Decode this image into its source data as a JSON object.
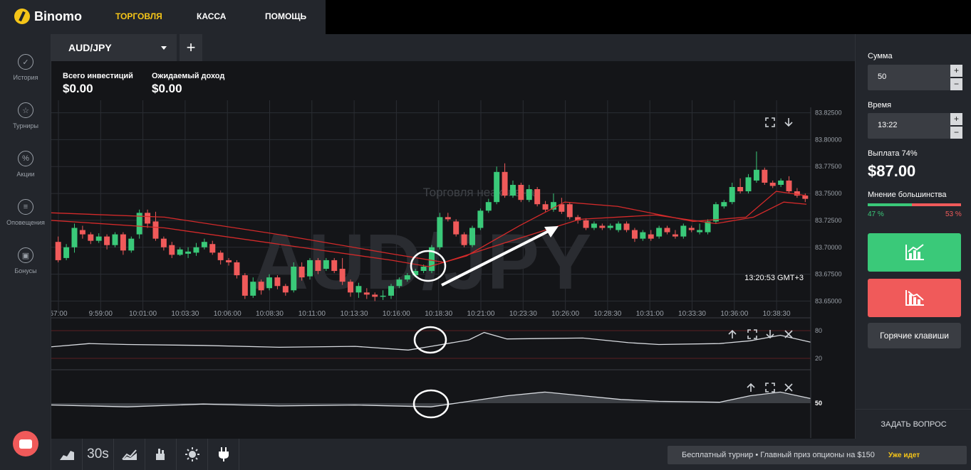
{
  "app": {
    "logo_text": "Binomo"
  },
  "nav": [
    {
      "label": "ТОРГОВЛЯ",
      "active": true
    },
    {
      "label": "КАССА",
      "active": false
    },
    {
      "label": "ПОМОЩЬ",
      "active": false
    }
  ],
  "sidebar": {
    "items": [
      {
        "label": "История",
        "icon": "check-icon"
      },
      {
        "label": "Турниры",
        "icon": "star-icon"
      },
      {
        "label": "Акции",
        "icon": "percent-icon"
      },
      {
        "label": "Оповещения",
        "icon": "list-icon"
      },
      {
        "label": "Бонусы",
        "icon": "gift-icon"
      }
    ]
  },
  "tabs": {
    "asset": "AUD/JPY",
    "add": "+"
  },
  "info": {
    "total_label": "Всего инвестиций",
    "total_value": "$0.00",
    "expected_label": "Ожидаемый доход",
    "expected_value": "$0.00"
  },
  "chart": {
    "watermark": "AUD/JPY",
    "status_text": "Торговля неактивна",
    "time_readout": "13:20:53 GMT+3",
    "price_ticks": [
      "83.82500",
      "83.80000",
      "83.77500",
      "83.75000",
      "83.72500",
      "83.70000",
      "83.67500",
      "83.65000"
    ],
    "time_ticks": [
      "57:00",
      "9:59:00",
      "10:01:00",
      "10:03:30",
      "10:06:00",
      "10:08:30",
      "10:11:00",
      "10:13:30",
      "10:16:00",
      "10:18:30",
      "10:21:00",
      "10:23:30",
      "10:26:00",
      "10:28:30",
      "10:31:00",
      "10:33:30",
      "10:36:00",
      "10:38:30"
    ],
    "osc1_ticks": [
      "80",
      "20"
    ],
    "osc2_ticks": [
      "50"
    ],
    "colors": {
      "up": "#3ac979",
      "down": "#f05a5a",
      "ma": "#d42a2a",
      "grid": "#2a2d33"
    }
  },
  "chart_data": {
    "type": "candlestick",
    "ylim": [
      83.645,
      83.83
    ],
    "candles": [
      [
        83.705,
        83.688,
        83.71,
        83.686
      ],
      [
        83.69,
        83.7,
        83.703,
        83.688
      ],
      [
        83.7,
        83.718,
        83.722,
        83.695
      ],
      [
        83.716,
        83.712,
        83.72,
        83.708
      ],
      [
        83.712,
        83.706,
        83.714,
        83.703
      ],
      [
        83.706,
        83.71,
        83.713,
        83.704
      ],
      [
        83.71,
        83.702,
        83.712,
        83.698
      ],
      [
        83.702,
        83.712,
        83.714,
        83.7
      ],
      [
        83.712,
        83.697,
        83.714,
        83.693
      ],
      [
        83.697,
        83.708,
        83.71,
        83.695
      ],
      [
        83.712,
        83.732,
        83.735,
        83.708
      ],
      [
        83.732,
        83.722,
        83.735,
        83.718
      ],
      [
        83.724,
        83.708,
        83.733,
        83.706
      ],
      [
        83.708,
        83.7,
        83.71,
        83.697
      ],
      [
        83.702,
        83.693,
        83.705,
        83.69
      ],
      [
        83.693,
        83.698,
        83.7,
        83.692
      ],
      [
        83.694,
        83.696,
        83.7,
        83.69
      ],
      [
        83.695,
        83.7,
        83.704,
        83.692
      ],
      [
        83.7,
        83.705,
        83.708,
        83.698
      ],
      [
        83.703,
        83.695,
        83.706,
        83.693
      ],
      [
        83.695,
        83.688,
        83.697,
        83.684
      ],
      [
        83.688,
        83.686,
        83.69,
        83.683
      ],
      [
        83.686,
        83.674,
        83.688,
        83.671
      ],
      [
        83.674,
        83.655,
        83.676,
        83.652
      ],
      [
        83.655,
        83.668,
        83.672,
        83.653
      ],
      [
        83.668,
        83.66,
        83.67,
        83.656
      ],
      [
        83.662,
        83.672,
        83.675,
        83.66
      ],
      [
        83.672,
        83.664,
        83.674,
        83.661
      ],
      [
        83.664,
        83.658,
        83.666,
        83.655
      ],
      [
        83.66,
        83.682,
        83.686,
        83.658
      ],
      [
        83.682,
        83.672,
        83.686,
        83.669
      ],
      [
        83.673,
        83.688,
        83.69,
        83.67
      ],
      [
        83.688,
        83.678,
        83.69,
        83.675
      ],
      [
        83.68,
        83.688,
        83.69,
        83.678
      ],
      [
        83.688,
        83.678,
        83.69,
        83.676
      ],
      [
        83.68,
        83.668,
        83.69,
        83.665
      ],
      [
        83.668,
        83.658,
        83.67,
        83.654
      ],
      [
        83.658,
        83.664,
        83.667,
        83.653
      ],
      [
        83.658,
        83.656,
        83.662,
        83.652
      ],
      [
        83.656,
        83.654,
        83.658,
        83.65
      ],
      [
        83.655,
        83.655,
        83.66,
        83.651
      ],
      [
        83.655,
        83.664,
        83.666,
        83.652
      ],
      [
        83.664,
        83.67,
        83.672,
        83.662
      ],
      [
        83.67,
        83.674,
        83.676,
        83.668
      ],
      [
        83.674,
        83.678,
        83.68,
        83.672
      ],
      [
        83.678,
        83.682,
        83.684,
        83.676
      ],
      [
        83.678,
        83.7,
        83.702,
        83.676
      ],
      [
        83.7,
        83.728,
        83.732,
        83.698
      ],
      [
        83.728,
        83.726,
        83.732,
        83.724
      ],
      [
        83.724,
        83.712,
        83.726,
        83.71
      ],
      [
        83.712,
        83.702,
        83.714,
        83.7
      ],
      [
        83.702,
        83.718,
        83.72,
        83.7
      ],
      [
        83.718,
        83.734,
        83.736,
        83.716
      ],
      [
        83.734,
        83.742,
        83.745,
        83.732
      ],
      [
        83.742,
        83.77,
        83.775,
        83.74
      ],
      [
        83.77,
        83.748,
        83.778,
        83.746
      ],
      [
        83.748,
        83.758,
        83.762,
        83.746
      ],
      [
        83.758,
        83.744,
        83.76,
        83.742
      ],
      [
        83.744,
        83.754,
        83.758,
        83.742
      ],
      [
        83.754,
        83.74,
        83.756,
        83.738
      ],
      [
        83.74,
        83.735,
        83.743,
        83.733
      ],
      [
        83.735,
        83.742,
        83.75,
        83.733
      ],
      [
        83.74,
        83.733,
        83.746,
        83.731
      ],
      [
        83.74,
        83.728,
        83.742,
        83.726
      ],
      [
        83.728,
        83.725,
        83.73,
        83.722
      ],
      [
        83.725,
        83.718,
        83.727,
        83.716
      ],
      [
        83.718,
        83.722,
        83.724,
        83.716
      ],
      [
        83.72,
        83.718,
        83.722,
        83.716
      ],
      [
        83.718,
        83.72,
        83.722,
        83.716
      ],
      [
        83.716,
        83.722,
        83.724,
        83.714
      ],
      [
        83.722,
        83.716,
        83.724,
        83.714
      ],
      [
        83.716,
        83.708,
        83.718,
        83.705
      ],
      [
        83.708,
        83.714,
        83.716,
        83.706
      ],
      [
        83.712,
        83.708,
        83.716,
        83.706
      ],
      [
        83.71,
        83.718,
        83.72,
        83.708
      ],
      [
        83.718,
        83.714,
        83.72,
        83.712
      ],
      [
        83.712,
        83.71,
        83.716,
        83.708
      ],
      [
        83.71,
        83.72,
        83.722,
        83.708
      ],
      [
        83.718,
        83.716,
        83.72,
        83.714
      ],
      [
        83.714,
        83.716,
        83.722,
        83.712
      ],
      [
        83.714,
        83.724,
        83.726,
        83.712
      ],
      [
        83.724,
        83.74,
        83.742,
        83.722
      ],
      [
        83.738,
        83.742,
        83.744,
        83.736
      ],
      [
        83.742,
        83.756,
        83.76,
        83.74
      ],
      [
        83.756,
        83.752,
        83.764,
        83.75
      ],
      [
        83.752,
        83.765,
        83.768,
        83.75
      ],
      [
        83.762,
        83.772,
        83.789,
        83.76
      ],
      [
        83.772,
        83.76,
        83.774,
        83.758
      ],
      [
        83.76,
        83.757,
        83.762,
        83.755
      ],
      [
        83.758,
        83.762,
        83.764,
        83.756
      ],
      [
        83.762,
        83.752,
        83.766,
        83.75
      ],
      [
        83.752,
        83.748,
        83.755,
        83.746
      ],
      [
        83.748,
        83.745,
        83.75,
        83.742
      ]
    ],
    "ma": [
      [
        0,
        83.725
      ],
      [
        0.15,
        83.718
      ],
      [
        0.3,
        83.703
      ],
      [
        0.45,
        83.688
      ],
      [
        0.5,
        83.682
      ],
      [
        0.55,
        83.692
      ],
      [
        0.62,
        83.72
      ],
      [
        0.68,
        83.742
      ],
      [
        0.75,
        83.738
      ],
      [
        0.85,
        83.724
      ],
      [
        0.92,
        83.728
      ],
      [
        0.96,
        83.752
      ],
      [
        1.0,
        83.748
      ]
    ],
    "ma2": [
      [
        0,
        83.732
      ],
      [
        0.15,
        83.728
      ],
      [
        0.3,
        83.712
      ],
      [
        0.45,
        83.694
      ],
      [
        0.52,
        83.686
      ],
      [
        0.6,
        83.704
      ],
      [
        0.7,
        83.726
      ],
      [
        0.8,
        83.73
      ],
      [
        0.88,
        83.722
      ],
      [
        0.93,
        83.728
      ],
      [
        0.97,
        83.742
      ],
      [
        1.0,
        83.74
      ]
    ],
    "osc1": [
      [
        0,
        45
      ],
      [
        0.05,
        52
      ],
      [
        0.1,
        50
      ],
      [
        0.2,
        48
      ],
      [
        0.3,
        44
      ],
      [
        0.4,
        46
      ],
      [
        0.47,
        38
      ],
      [
        0.5,
        46
      ],
      [
        0.55,
        60
      ],
      [
        0.57,
        76
      ],
      [
        0.6,
        62
      ],
      [
        0.7,
        64
      ],
      [
        0.76,
        54
      ],
      [
        0.8,
        50
      ],
      [
        0.88,
        52
      ],
      [
        0.92,
        58
      ],
      [
        0.96,
        70
      ],
      [
        1.0,
        55
      ]
    ],
    "osc2": [
      [
        0,
        48
      ],
      [
        0.1,
        46
      ],
      [
        0.2,
        49
      ],
      [
        0.3,
        47
      ],
      [
        0.4,
        48
      ],
      [
        0.5,
        46
      ],
      [
        0.55,
        52
      ],
      [
        0.6,
        58
      ],
      [
        0.65,
        62
      ],
      [
        0.7,
        58
      ],
      [
        0.75,
        54
      ],
      [
        0.8,
        52
      ],
      [
        0.88,
        51
      ],
      [
        0.92,
        58
      ],
      [
        0.96,
        62
      ],
      [
        1.0,
        55
      ]
    ]
  },
  "right_panel": {
    "amount_label": "Сумма",
    "amount_value": "50",
    "time_label": "Время",
    "time_value": "13:22",
    "payout_label": "Выплата 74%",
    "payout_value": "$87.00",
    "majority_label": "Мнение большинства",
    "majority_up_pct": "47 %",
    "majority_down_pct": "53 %",
    "majority_up_fraction": 0.47,
    "hotkeys_label": "Горячие клавиши",
    "ask_label": "ЗАДАТЬ ВОПРОС",
    "step_plus": "+",
    "step_minus": "−"
  },
  "bottom": {
    "tool_30s": "30s",
    "tournament_text": "Бесплатный турнир • Главный приз опционы на $150",
    "tournament_status": "Уже идет"
  }
}
